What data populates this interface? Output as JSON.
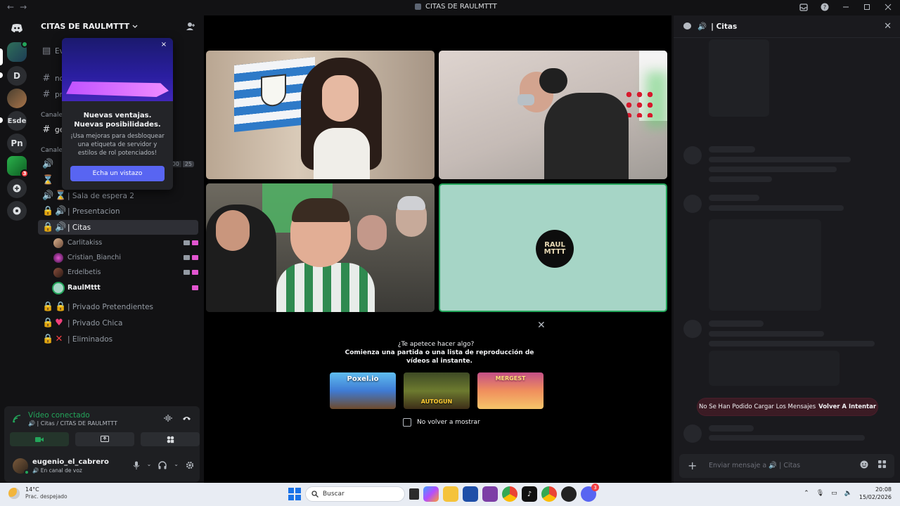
{
  "window": {
    "title": "CITAS DE RAULMTTT",
    "back": "←",
    "forward": "→"
  },
  "rail": {
    "servers": [
      {
        "label": "D"
      },
      {
        "label": "Esde"
      },
      {
        "label": "Pn"
      },
      {
        "label": "",
        "badge": "3"
      }
    ]
  },
  "sidebar": {
    "server_name": "CITAS DE RAULMTTT",
    "events_label": "Ev",
    "channels_top": [
      {
        "name": "no"
      },
      {
        "name": "pr"
      }
    ],
    "category1": "Canale",
    "channel_ge": "ge",
    "category2": "Canale",
    "voice_counts": [
      "00",
      "25"
    ],
    "voice_channels": [
      {
        "icon": "⌛",
        "name": "| Sala de espera 2"
      },
      {
        "icon": "🔊",
        "name": "| Presentacion"
      },
      {
        "icon": "🔊",
        "name": "| Citas"
      }
    ],
    "members": [
      {
        "name": "Carlitakiss"
      },
      {
        "name": "Cristian_Bianchi"
      },
      {
        "name": "Erdelbetis"
      },
      {
        "name": "RaulMttt"
      }
    ],
    "private_channels": [
      {
        "name": "| Privado Pretendientes"
      },
      {
        "name": "| Privado Chica"
      },
      {
        "name": "| Eliminados"
      }
    ]
  },
  "popup": {
    "title": "Nuevas ventajas. Nuevas posibilidades.",
    "body": "¡Usa mejoras para desbloquear una etiqueta de servidor y estilos de rol potenciados!",
    "cta": "Echa un vistazo",
    "close": "×"
  },
  "voice_panel": {
    "status": "Vídeo conectado",
    "channel_path": "| Citas / CITAS DE RAULMTTT"
  },
  "user": {
    "name": "eugenio_el_cabrero",
    "status": "En canal de voz"
  },
  "stage": {
    "avatar_text_1": "RAUL",
    "avatar_text_2": "MTTT",
    "activity_close": "✕",
    "activity_title": "¿Te apetece hacer algo?",
    "activity_subtitle": "Comienza una partida o una lista de reproducción de vídeos al instante.",
    "games": [
      {
        "label": "Poxel.io"
      },
      {
        "label": "AUTOGUN"
      },
      {
        "label": "MERGEST"
      }
    ],
    "dont_show": "No volver a mostrar"
  },
  "chat": {
    "title": "| Citas",
    "error_text": "No Se Han Podido Cargar Los Mensajes",
    "retry": "Volver A Intentar",
    "placeholder": "Enviar mensaje a 🔊 | Citas"
  },
  "taskbar": {
    "temp": "14°C",
    "condition": "Prac. despejado",
    "search": "Buscar",
    "time": "20:08",
    "date": "15/02/2026",
    "discord_badge": "3"
  },
  "colors": {
    "accent": "#5865f2",
    "online": "#23a55a",
    "error": "#f23f43"
  }
}
